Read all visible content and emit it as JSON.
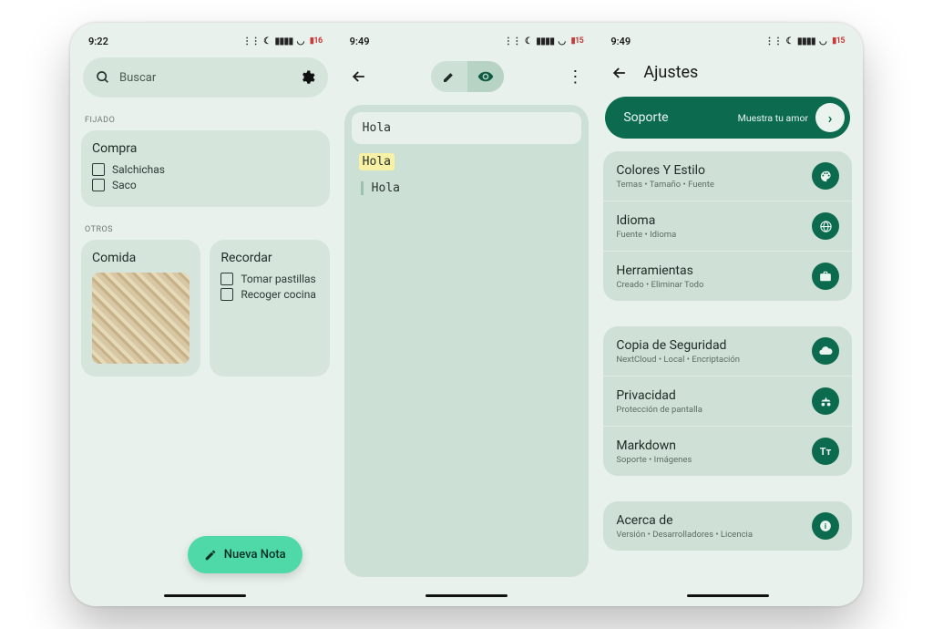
{
  "pane1": {
    "time": "9:22",
    "battery": "16",
    "search_placeholder": "Buscar",
    "section_pinned": "FIJADO",
    "section_others": "OTROS",
    "card_compra": {
      "title": "Compra",
      "items": [
        "Salchichas",
        "Saco"
      ]
    },
    "card_comida": {
      "title": "Comida"
    },
    "card_recordar": {
      "title": "Recordar",
      "items": [
        "Tomar pastillas",
        "Recoger cocina"
      ]
    },
    "fab_label": "Nueva Nota"
  },
  "pane2": {
    "time": "9:49",
    "battery": "15",
    "search_value": "Hola",
    "line_highlight": "Hola",
    "line_indent": "Hola"
  },
  "pane3": {
    "time": "9:49",
    "battery": "15",
    "title": "Ajustes",
    "support": {
      "label": "Soporte",
      "cta": "Muestra tu amor"
    },
    "items": [
      {
        "title": "Colores Y Estilo",
        "sub": "Temas  •  Tamaño  •  Fuente"
      },
      {
        "title": "Idioma",
        "sub": "Fuente  •  Idioma"
      },
      {
        "title": "Herramientas",
        "sub": "Creado  •  Eliminar Todo"
      },
      {
        "title": "Copia de Seguridad",
        "sub": "NextCloud  •  Local  •  Encriptación"
      },
      {
        "title": "Privacidad",
        "sub": "Protección de pantalla"
      },
      {
        "title": "Markdown",
        "sub": "Soporte  •  Imágenes"
      },
      {
        "title": "Acerca de",
        "sub": "Versión  •  Desarrolladores  •  Licencia"
      }
    ]
  }
}
